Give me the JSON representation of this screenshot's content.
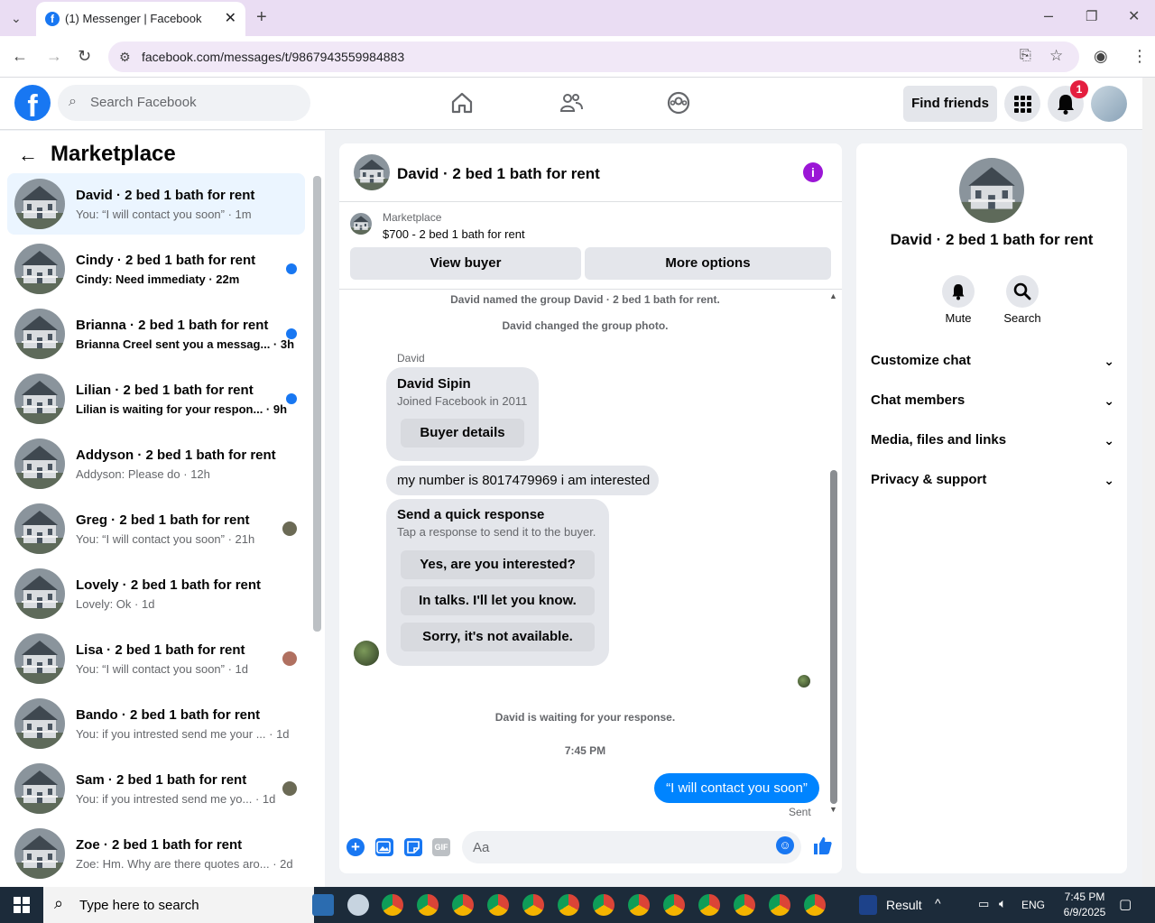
{
  "browser": {
    "tab_title": "(1) Messenger | Facebook",
    "url": "facebook.com/messages/t/9867943559984883"
  },
  "header": {
    "search_placeholder": "Search Facebook",
    "find_friends": "Find friends",
    "notification_count": "1"
  },
  "sidebar": {
    "title": "Marketplace",
    "conversations": [
      {
        "name": "David · 2 bed 1 bath for rent",
        "preview": "You: “I will contact you soon” · 1m",
        "unread": false
      },
      {
        "name": "Cindy · 2 bed 1 bath for rent",
        "preview": "Cindy: Need immediaty · 22m",
        "unread": true
      },
      {
        "name": "Brianna · 2 bed 1 bath for rent",
        "preview": "Brianna Creel sent you a messag... · 3h",
        "unread": true
      },
      {
        "name": "Lilian · 2 bed 1 bath for rent",
        "preview": "Lilian is waiting for your respon... · 9h",
        "unread": true
      },
      {
        "name": "Addyson · 2 bed 1 bath for rent",
        "preview": "Addyson: Please do · 12h",
        "unread": false
      },
      {
        "name": "Greg · 2 bed 1 bath for rent",
        "preview": "You: “I will contact you soon” · 21h",
        "unread": false
      },
      {
        "name": "Lovely · 2 bed 1 bath for rent",
        "preview": "Lovely: Ok · 1d",
        "unread": false
      },
      {
        "name": "Lisa · 2 bed 1 bath for rent",
        "preview": "You: “I will contact you soon” · 1d",
        "unread": false
      },
      {
        "name": "Bando · 2 bed 1 bath for rent",
        "preview": "You: if you intrested send me your ... · 1d",
        "unread": false
      },
      {
        "name": "Sam · 2 bed 1 bath for rent",
        "preview": "You: if you intrested send me yo... · 1d",
        "unread": false
      },
      {
        "name": "Zoe · 2 bed 1 bath for rent",
        "preview": "Zoe: Hm. Why are there quotes aro... · 2d",
        "unread": false
      }
    ]
  },
  "chat": {
    "title": "David · 2 bed 1 bath for rent",
    "marketplace_label": "Marketplace",
    "listing": "$700 - 2 bed 1 bath for rent",
    "view_buyer": "View buyer",
    "more_options": "More options",
    "system_1": "David named the group David · 2 bed 1 bath for rent.",
    "system_2": "David changed the group photo.",
    "sender": "David",
    "profile_name": "David Sipin",
    "profile_joined": "Joined Facebook in 2011",
    "buyer_details": "Buyer details",
    "message_1": "my number is 8017479969 i am interested",
    "quick_title": "Send a quick response",
    "quick_sub": "Tap a response to send it to the buyer.",
    "quick_1": "Yes, are you interested?",
    "quick_2": "In talks. I'll let you know.",
    "quick_3": "Sorry, it's not available.",
    "waiting": "David is waiting for your response.",
    "time": "7:45 PM",
    "my_message": "“I will contact you soon”",
    "sent": "Sent",
    "input_placeholder": "Aa",
    "gif_label": "GIF"
  },
  "details": {
    "title": "David · 2 bed 1 bath for rent",
    "mute": "Mute",
    "search": "Search",
    "rows": [
      "Customize chat",
      "Chat members",
      "Media, files and links",
      "Privacy & support"
    ]
  },
  "taskbar": {
    "search_placeholder": "Type here to search",
    "result": "Result",
    "lang": "ENG",
    "time": "7:45 PM",
    "date": "6/9/2025"
  },
  "colors": {
    "brand": "#1877f2",
    "my_bubble": "#0084ff",
    "info": "#9b16d6",
    "badge": "#e41e3f"
  }
}
